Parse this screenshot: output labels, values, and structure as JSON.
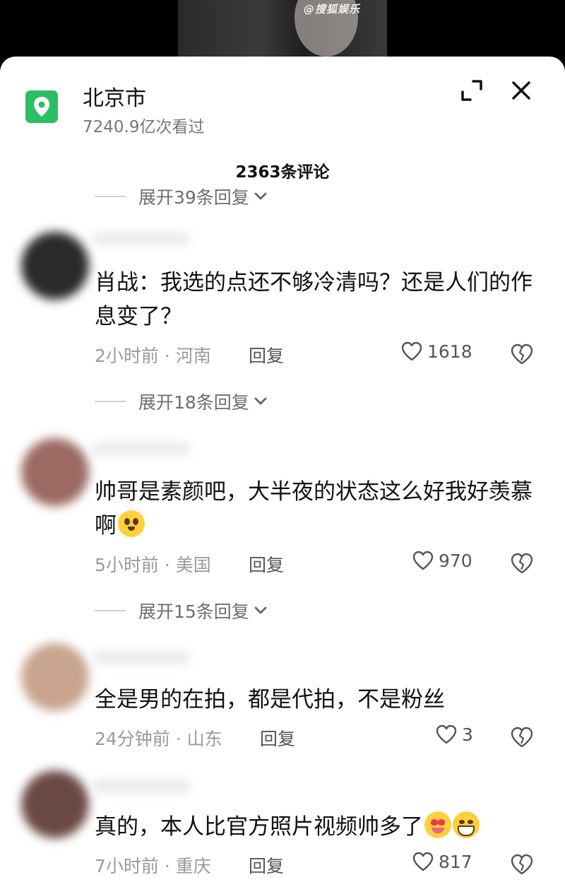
{
  "video": {
    "watermark": "@搜狐娱乐"
  },
  "header": {
    "location_title": "北京市",
    "views": "7240.9亿次看过",
    "comment_count": "2363条评论",
    "icons": {
      "location": "location-pin-icon",
      "expand": "expand-icon",
      "close": "close-icon"
    },
    "accent_color": "#2bbf63"
  },
  "top_partial_reply": {
    "label": "展开39条回复"
  },
  "comments": [
    {
      "text": "肖战：我选的点还不够冷清吗？还是人们的作息变了？",
      "time_location": "2小时前 · 河南",
      "reply_label": "回复",
      "likes": "1618",
      "expand_replies": "展开18条回复"
    },
    {
      "text": "帅哥是素颜吧，大半夜的状态这么好我好羡慕啊",
      "emoji": [
        "pleading-face-emoji"
      ],
      "time_location": "5小时前 · 美国",
      "reply_label": "回复",
      "likes": "970",
      "expand_replies": "展开15条回复"
    },
    {
      "text": "全是男的在拍，都是代拍，不是粉丝",
      "time_location": "24分钟前 · 山东",
      "reply_label": "回复",
      "likes": "3"
    },
    {
      "text": "真的，本人比官方照片视频帅多了",
      "emoji": [
        "heart-eyes-tongue-emoji",
        "grinning-face-emoji"
      ],
      "time_location": "7小时前 · 重庆",
      "reply_label": "回复",
      "likes": "817"
    }
  ]
}
